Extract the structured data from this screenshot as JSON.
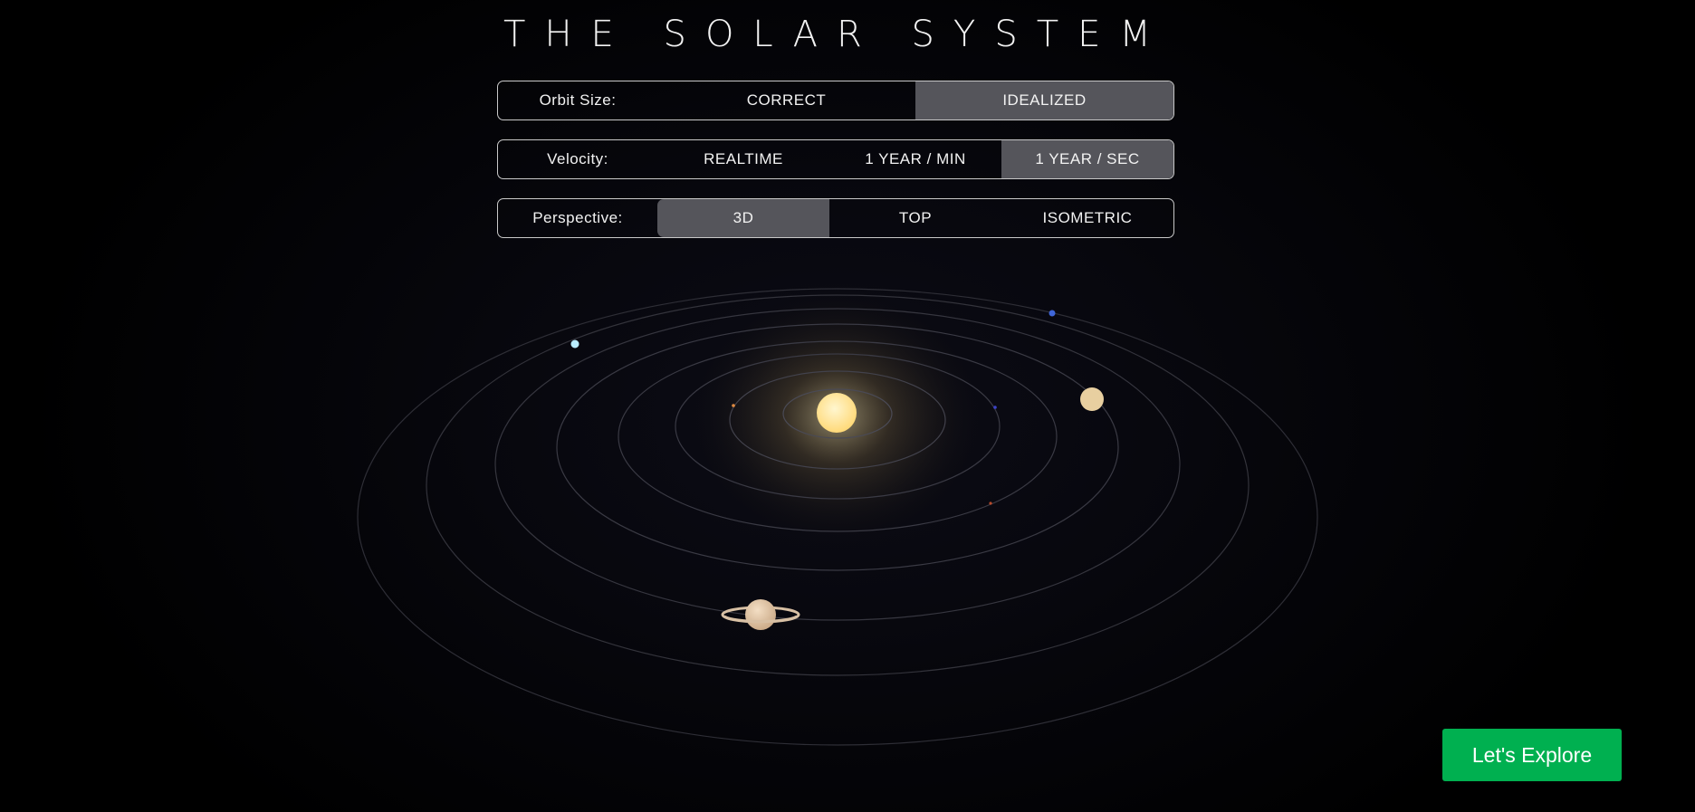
{
  "page": {
    "title": "THE SOLAR SYSTEM"
  },
  "controls": {
    "orbit_size": {
      "label": "Orbit Size:",
      "options": [
        "CORRECT",
        "IDEALIZED"
      ],
      "selected": "IDEALIZED"
    },
    "velocity": {
      "label": "Velocity:",
      "options": [
        "REALTIME",
        "1 YEAR / MIN",
        "1 YEAR / SEC"
      ],
      "selected": "1 YEAR / SEC"
    },
    "perspective": {
      "label": "Perspective:",
      "options": [
        "3D",
        "TOP",
        "ISOMETRIC"
      ],
      "selected": "3D"
    }
  },
  "cta": {
    "label": "Let's Explore"
  },
  "colors": {
    "background": "#000000",
    "active_option": "#55555b",
    "cta_green": "#00b050",
    "sun": "#ffe08a",
    "orbit_line": "#3a3a44"
  },
  "scene": {
    "sun": {
      "name": "sun-icon",
      "color": "#ffe39a"
    },
    "planets": [
      {
        "name": "mercury-icon",
        "color": "#e08a40"
      },
      {
        "name": "venus-icon",
        "color": "#3b42c8"
      },
      {
        "name": "earth-icon",
        "color": "#b84a2a"
      },
      {
        "name": "mars-icon",
        "color": "#e8cfa0"
      },
      {
        "name": "jupiter-icon",
        "color": "#3f66d9"
      },
      {
        "name": "saturn-icon",
        "color": "#dcc1a1"
      },
      {
        "name": "uranus-icon",
        "color": "#b9ecff"
      }
    ]
  }
}
